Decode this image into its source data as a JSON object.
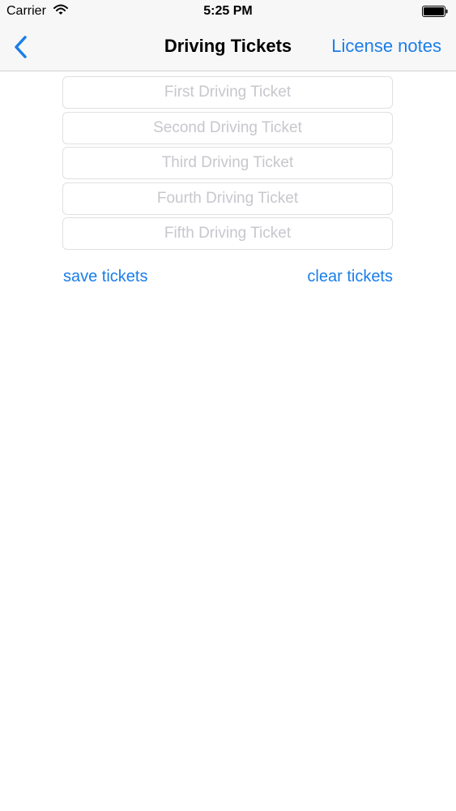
{
  "status_bar": {
    "carrier": "Carrier",
    "time": "5:25 PM"
  },
  "nav": {
    "title": "Driving Tickets",
    "right_button": "License notes",
    "back_icon": "chevron-left-icon"
  },
  "tickets": [
    {
      "value": "",
      "placeholder": "First Driving Ticket"
    },
    {
      "value": "",
      "placeholder": "Second Driving Ticket"
    },
    {
      "value": "",
      "placeholder": "Third Driving Ticket"
    },
    {
      "value": "",
      "placeholder": "Fourth Driving Ticket"
    },
    {
      "value": "",
      "placeholder": "Fifth Driving Ticket"
    }
  ],
  "actions": {
    "save": "save tickets",
    "clear": "clear tickets"
  },
  "colors": {
    "accent": "#1a7ee8",
    "placeholder": "#c7c7cd",
    "bar_background": "#f7f7f8"
  }
}
